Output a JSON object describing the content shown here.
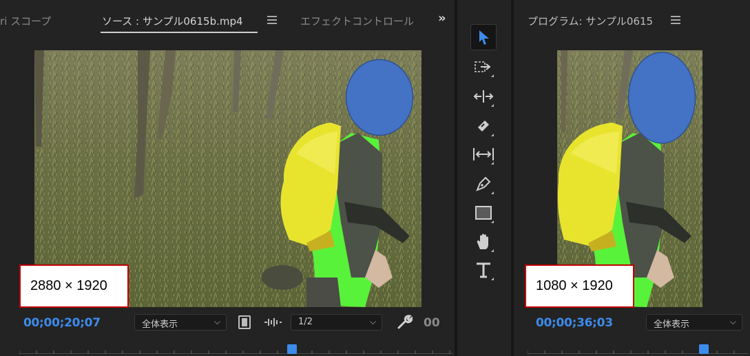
{
  "source_panel": {
    "tabs": [
      {
        "label": "ri スコープ",
        "active": false
      },
      {
        "label": "ソース : サンプル0615b.mp4",
        "active": true
      },
      {
        "label": "エフェクトコントロール",
        "active": false
      }
    ],
    "overflow_label": "»",
    "resolution_label": "2880 × 1920",
    "timecode": "00;00;20;07",
    "zoom_select": "全体表示",
    "resolution_select": "1/2",
    "trailing_timecode": "00"
  },
  "program_panel": {
    "title": "プログラム: サンプル0615",
    "resolution_label": "1080 × 1920",
    "timecode": "00;00;36;03",
    "zoom_select": "全体表示"
  },
  "tools": [
    {
      "name": "selection-tool",
      "icon": "arrow-icon",
      "active": true
    },
    {
      "name": "track-select-tool",
      "icon": "track-select-icon"
    },
    {
      "name": "ripple-edit-tool",
      "icon": "ripple-edit-icon"
    },
    {
      "name": "razor-tool",
      "icon": "razor-icon"
    },
    {
      "name": "slip-tool",
      "icon": "slip-icon"
    },
    {
      "name": "pen-tool",
      "icon": "pen-icon"
    },
    {
      "name": "rectangle-tool",
      "icon": "rectangle-icon"
    },
    {
      "name": "hand-tool",
      "icon": "hand-icon"
    },
    {
      "name": "type-tool",
      "icon": "type-icon"
    }
  ],
  "colors": {
    "accent_blue": "#3d8bea",
    "face_mask": "#4472c4",
    "highlight_border": "#c00000"
  }
}
